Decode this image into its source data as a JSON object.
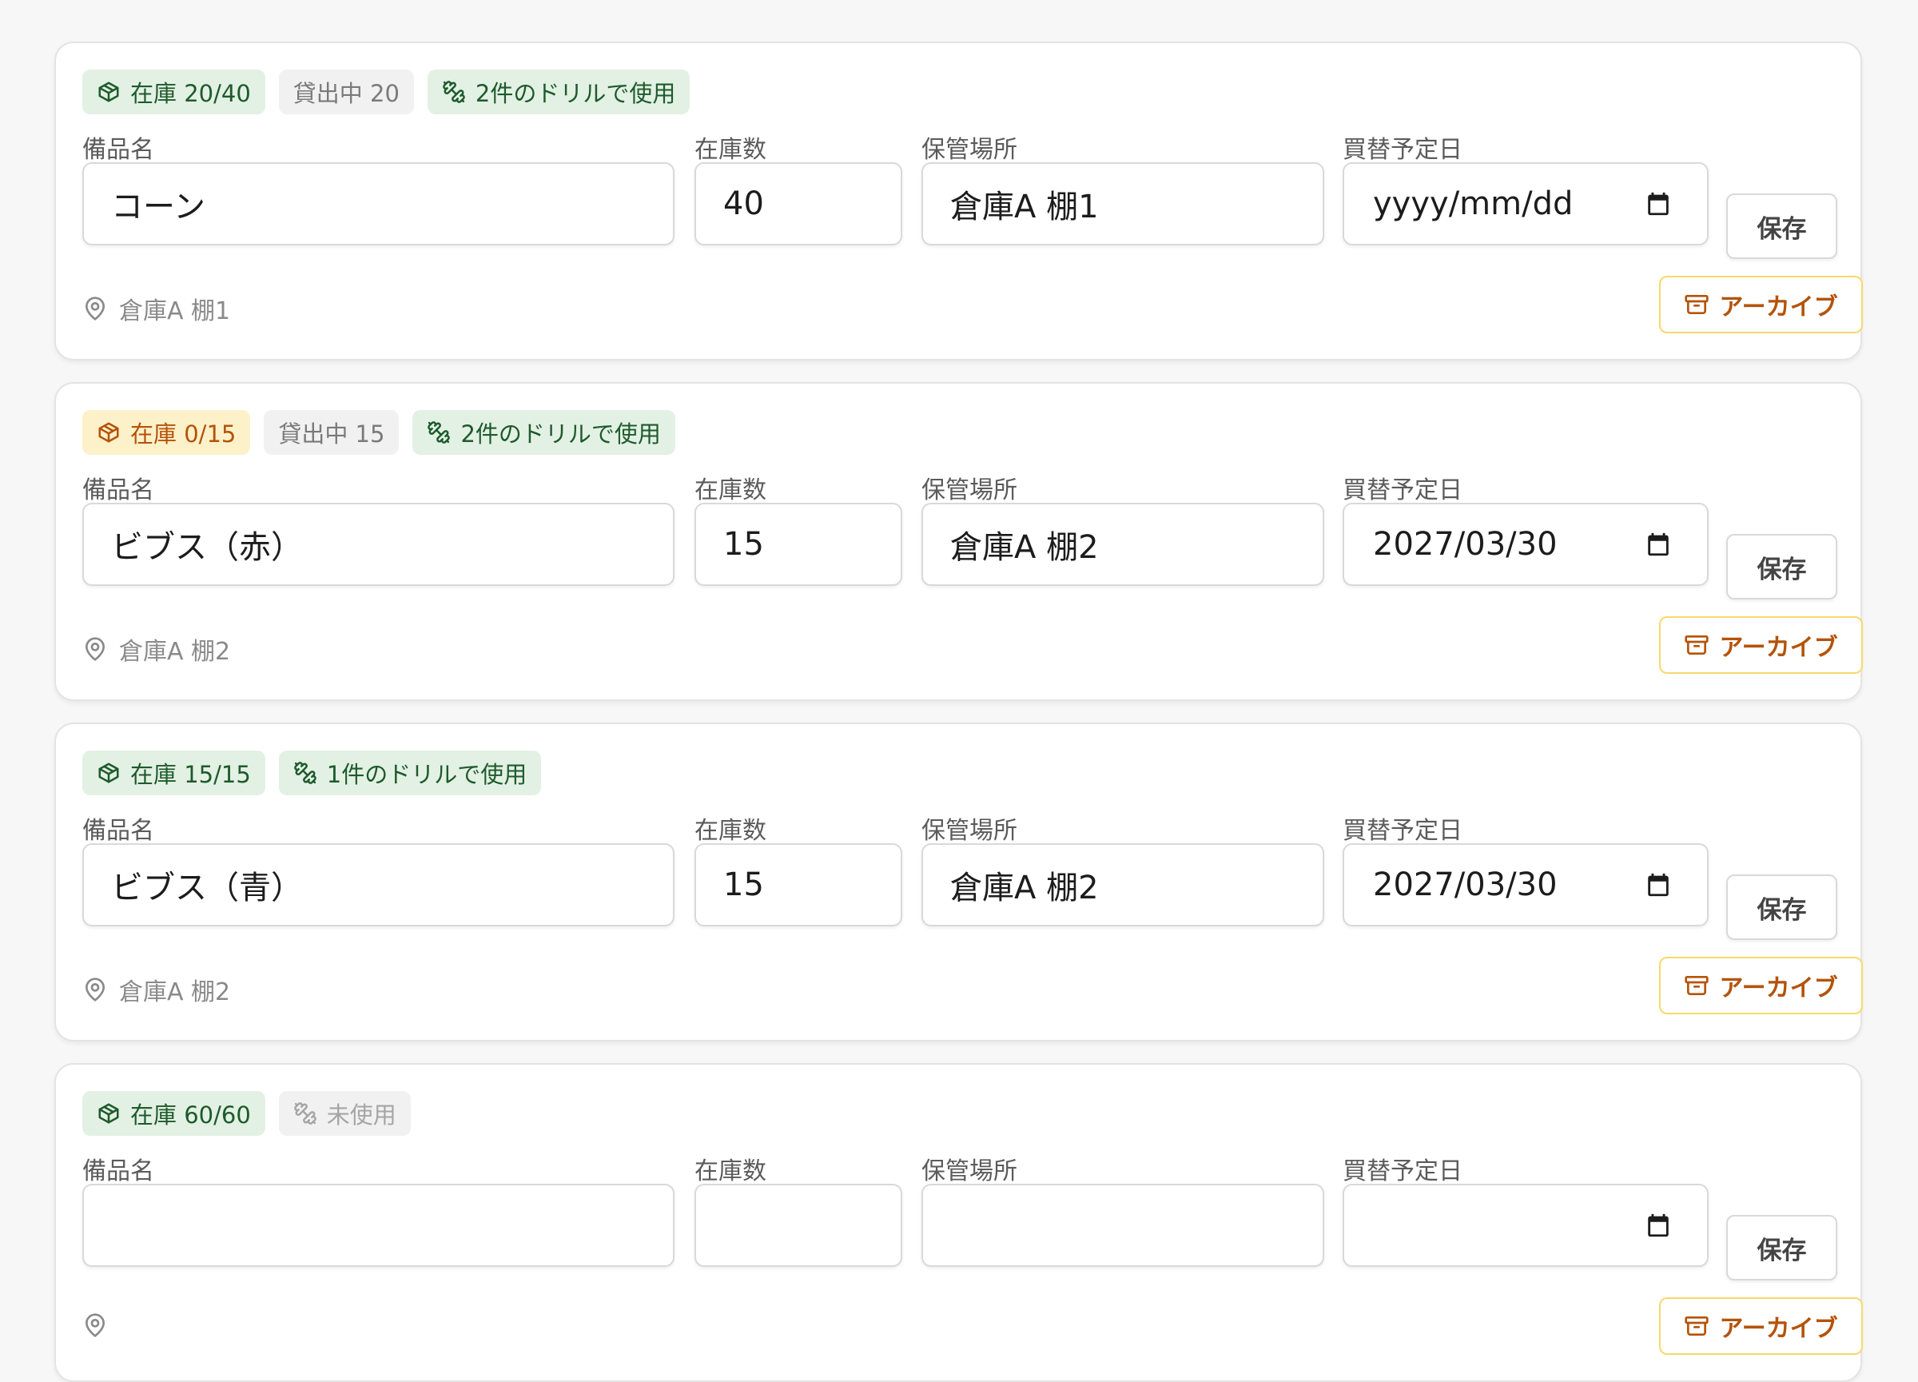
{
  "labels": {
    "name": "備品名",
    "qty": "在庫数",
    "location": "保管場所",
    "replace_date": "買替予定日",
    "save": "保存",
    "archive": "アーカイブ"
  },
  "items": [
    {
      "name": "コーン",
      "quantity": "40",
      "location": "倉庫A 棚1",
      "replace_date": "",
      "date_placeholder": "yyyy/mm/dd",
      "badges": [
        {
          "text": "在庫 20/40",
          "style": "ok",
          "icon": "package-icon"
        },
        {
          "text": "貸出中 20",
          "style": "gray",
          "icon": ""
        },
        {
          "text": "2件のドリルで使用",
          "style": "ok",
          "icon": "dumbbell-icon"
        }
      ]
    },
    {
      "name": "ビブス（赤）",
      "quantity": "15",
      "location": "倉庫A 棚2",
      "replace_date": "2027/03/30",
      "date_placeholder": "yyyy/mm/dd",
      "badges": [
        {
          "text": "在庫 0/15",
          "style": "warn",
          "icon": "package-icon"
        },
        {
          "text": "貸出中 15",
          "style": "gray",
          "icon": ""
        },
        {
          "text": "2件のドリルで使用",
          "style": "ok",
          "icon": "dumbbell-icon"
        }
      ]
    },
    {
      "name": "ビブス（青）",
      "quantity": "15",
      "location": "倉庫A 棚2",
      "replace_date": "2027/03/30",
      "date_placeholder": "yyyy/mm/dd",
      "badges": [
        {
          "text": "在庫 15/15",
          "style": "ok",
          "icon": "package-icon"
        },
        {
          "text": "1件のドリルで使用",
          "style": "ok",
          "icon": "dumbbell-icon"
        }
      ]
    },
    {
      "name": "",
      "quantity": "",
      "location": "",
      "replace_date": "",
      "date_placeholder": "",
      "badges": [
        {
          "text": "在庫 60/60",
          "style": "ok",
          "icon": "package-icon"
        },
        {
          "text": "未使用",
          "style": "muted",
          "icon": "dumbbell-icon"
        }
      ]
    }
  ],
  "colors": {
    "ok_bg": "#e3f1e4",
    "ok_text": "#1e5a2c",
    "warn_bg": "#fdf1c9",
    "warn_text": "#b45309",
    "archive_border": "#f8d96a",
    "archive_text": "#b45309"
  }
}
